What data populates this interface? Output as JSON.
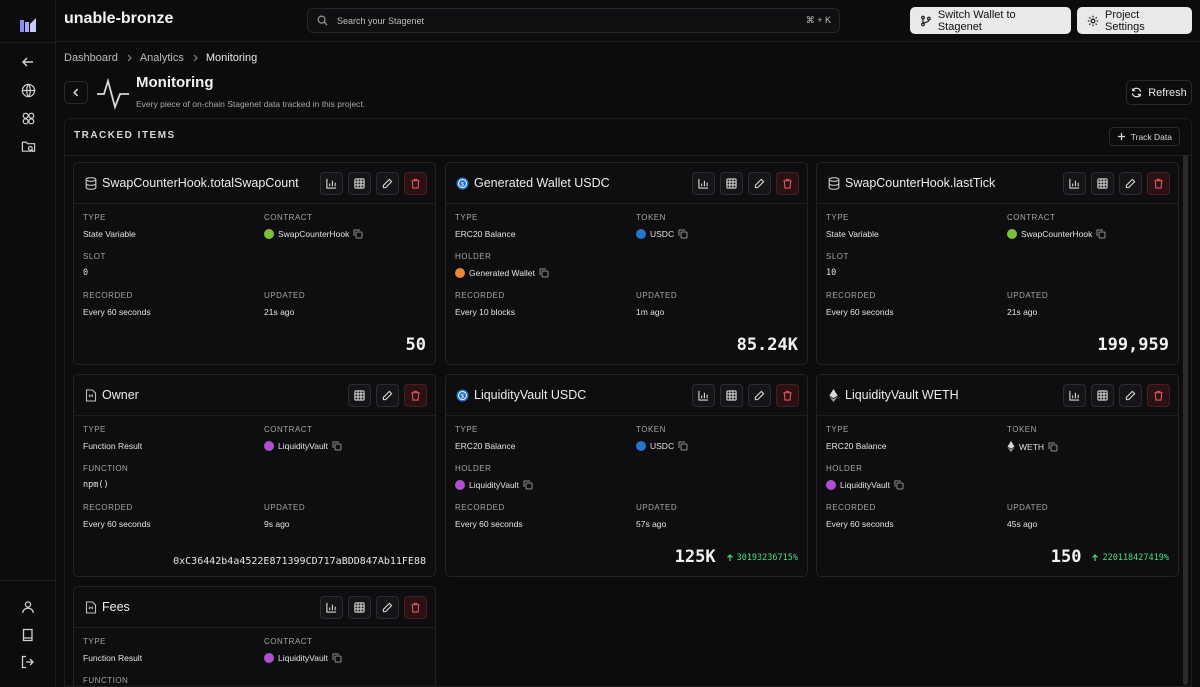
{
  "project": {
    "name": "unable-bronze"
  },
  "search": {
    "placeholder": "Search your Stagenet",
    "shortcut": "⌘ + K"
  },
  "topbar": {
    "switch_wallet_label": "Switch Wallet to Stagenet",
    "project_settings_label": "Project Settings"
  },
  "breadcrumb": [
    "Dashboard",
    "Analytics",
    "Monitoring"
  ],
  "page": {
    "title": "Monitoring",
    "subtitle": "Every piece of on-chain Stagenet data tracked in this project.",
    "refresh_label": "Refresh"
  },
  "tracked": {
    "title": "TRACKED ITEMS",
    "track_label": "Track Data"
  },
  "colors": {
    "background": "#0c0c0d",
    "delete": "#e2575e",
    "positive": "#4ade80",
    "usdc": "#2775ca",
    "hook": "#7bbf3a",
    "vault": "#b14fd1"
  },
  "cards": [
    {
      "icon": "database-icon",
      "title": "SwapCounterHook.totalSwapCount",
      "fields": [
        {
          "label": "TYPE",
          "value": "State Variable"
        },
        {
          "label": "CONTRACT",
          "value": "SwapCounterHook"
        },
        {
          "label": "SLOT",
          "value": "0"
        },
        {
          "label": "RECORDED",
          "value": "Every 60 seconds"
        },
        {
          "label": "UPDATED",
          "value": "21s ago"
        }
      ],
      "value": "50"
    },
    {
      "icon": "usdc-icon",
      "title": "Generated Wallet USDC",
      "fields": [
        {
          "label": "TYPE",
          "value": "ERC20 Balance"
        },
        {
          "label": "TOKEN",
          "value": "USDC"
        },
        {
          "label": "HOLDER",
          "value": "Generated Wallet"
        },
        {
          "label": "RECORDED",
          "value": "Every 10 blocks"
        },
        {
          "label": "UPDATED",
          "value": "1m ago"
        }
      ],
      "value": "85.24K"
    },
    {
      "icon": "database-icon",
      "title": "SwapCounterHook.lastTick",
      "fields": [
        {
          "label": "TYPE",
          "value": "State Variable"
        },
        {
          "label": "CONTRACT",
          "value": "SwapCounterHook"
        },
        {
          "label": "SLOT",
          "value": "10"
        },
        {
          "label": "RECORDED",
          "value": "Every 60 seconds"
        },
        {
          "label": "UPDATED",
          "value": "21s ago"
        }
      ],
      "value": "199,959"
    },
    {
      "icon": "function-file-icon",
      "title": "Owner",
      "fields": [
        {
          "label": "TYPE",
          "value": "Function Result"
        },
        {
          "label": "CONTRACT",
          "value": "LiquidityVault"
        },
        {
          "label": "FUNCTION",
          "value": "npm()"
        },
        {
          "label": "RECORDED",
          "value": "Every 60 seconds"
        },
        {
          "label": "UPDATED",
          "value": "9s ago"
        }
      ],
      "value": "0xC36442b4a4522E871399CD717aBDD847Ab11FE88"
    },
    {
      "icon": "usdc-icon",
      "title": "LiquidityVault USDC",
      "fields": [
        {
          "label": "TYPE",
          "value": "ERC20 Balance"
        },
        {
          "label": "TOKEN",
          "value": "USDC"
        },
        {
          "label": "HOLDER",
          "value": "LiquidityVault"
        },
        {
          "label": "RECORDED",
          "value": "Every 60 seconds"
        },
        {
          "label": "UPDATED",
          "value": "57s ago"
        }
      ],
      "value": "125K",
      "change": "30193236715%"
    },
    {
      "icon": "weth-icon",
      "title": "LiquidityVault WETH",
      "fields": [
        {
          "label": "TYPE",
          "value": "ERC20 Balance"
        },
        {
          "label": "TOKEN",
          "value": "WETH"
        },
        {
          "label": "HOLDER",
          "value": "LiquidityVault"
        },
        {
          "label": "RECORDED",
          "value": "Every 60 seconds"
        },
        {
          "label": "UPDATED",
          "value": "45s ago"
        }
      ],
      "value": "150",
      "change": "220118427419%"
    },
    {
      "icon": "function-file-icon",
      "title": "Fees",
      "fields": [
        {
          "label": "TYPE",
          "value": "Function Result"
        },
        {
          "label": "CONTRACT",
          "value": "LiquidityVault"
        },
        {
          "label": "FUNCTION",
          "value": ""
        }
      ]
    }
  ]
}
